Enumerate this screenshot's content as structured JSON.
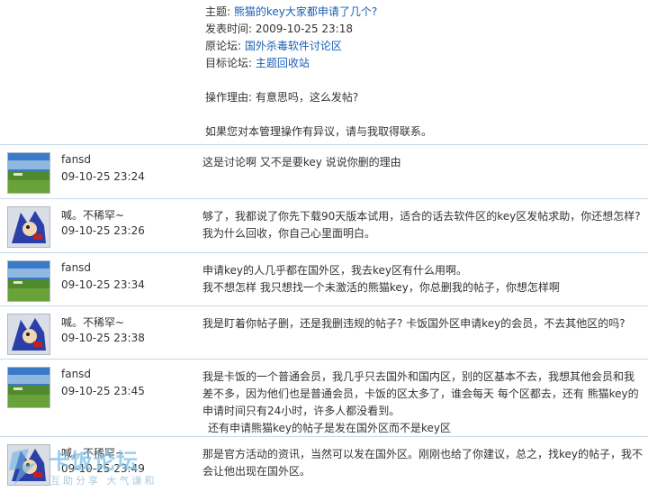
{
  "notice": {
    "subject_label": "主题: ",
    "subject": "熊猫的key大家都申请了几个?",
    "time_label": "发表时间: ",
    "time": "2009-10-25 23:18",
    "origin_label": "原论坛: ",
    "origin": "国外杀毒软件讨论区",
    "target_label": "目标论坛: ",
    "target": "主题回收站",
    "reason_label": "操作理由: ",
    "reason": "有意思吗，这么发帖?",
    "objection": "如果您对本管理操作有异议，请与我取得联系。"
  },
  "posts": [
    {
      "user": "fansd",
      "time": "09-10-25 23:24",
      "lines": [
        "这是讨论啊 又不是要key  说说你删的理由"
      ]
    },
    {
      "user": "喊。不稀罕~",
      "time": "09-10-25 23:26",
      "lines": [
        "够了，我都说了你先下载90天版本试用，适合的话去软件区的key区发帖求助，你还想怎样?",
        "我为什么回收，你自己心里面明白。"
      ]
    },
    {
      "user": "fansd",
      "time": "09-10-25 23:34",
      "lines": [
        "申请key的人几乎都在国外区，我去key区有什么用啊。",
        "我不想怎样 我只想找一个未激活的熊猫key，你总删我的帖子，你想怎样啊"
      ]
    },
    {
      "user": "喊。不稀罕~",
      "time": "09-10-25 23:38",
      "lines": [
        "我是盯着你帖子删，还是我删违规的帖子? 卡饭国外区申请key的会员，不去其他区的吗?"
      ]
    },
    {
      "user": "fansd",
      "time": "09-10-25 23:45",
      "lines": [
        "我是卡饭的一个普通会员，我几乎只去国外和国内区，别的区基本不去，我想其他会员和我",
        "差不多，因为他们也是普通会员，卡饭的区太多了，谁会每天 每个区都去，还有 熊猫key的",
        "申请时间只有24小时，许多人都没看到。",
        "还有申请熊猫key的帖子是发在国外区而不是key区"
      ]
    },
    {
      "user": "喊。不稀罕~",
      "time": "09-10-25 23:49",
      "lines": [
        "那是官方活动的资讯，当然可以发在国外区。刚刚也给了你建议，总之，找key的帖子，我不",
        "会让他出现在国外区。"
      ]
    }
  ],
  "watermark": {
    "title": "卡饭论坛",
    "subtitle": "互助分享  大气谦和"
  }
}
